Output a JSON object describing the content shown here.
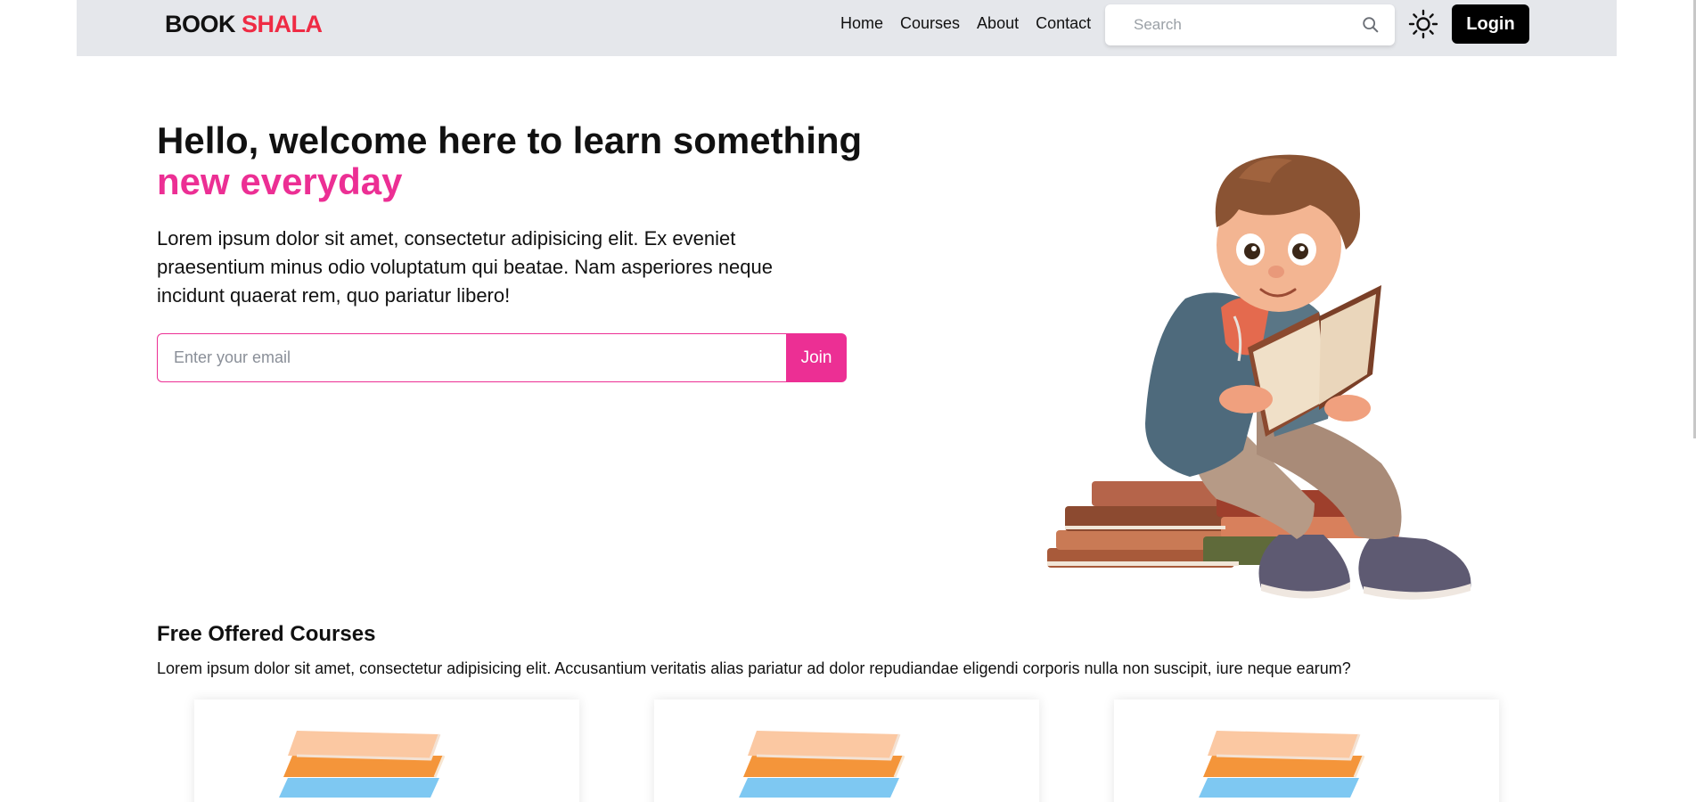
{
  "brand": {
    "part1": "BOOK",
    "part2": "SHALA",
    "accent_color": "#ef2b44"
  },
  "nav": {
    "items": [
      {
        "label": "Home"
      },
      {
        "label": "Courses"
      },
      {
        "label": "About"
      },
      {
        "label": "Contact"
      }
    ]
  },
  "search": {
    "placeholder": "Search",
    "icon": "search-icon"
  },
  "theme_toggle": {
    "icon": "sun-icon"
  },
  "login": {
    "label": "Login"
  },
  "hero": {
    "title": "Hello, welcome here to learn something",
    "title_accent": "new everyday",
    "accent_color": "#ec2f94",
    "description": "Lorem ipsum dolor sit amet, consectetur adipisicing elit. Ex eveniet praesentium minus odio voluptatum qui beatae. Nam asperiores neque incidunt quaerat rem, quo pariatur libero!",
    "email_placeholder": "Enter your email",
    "join_label": "Join",
    "illustration": "boy-reading-book-on-books-illustration"
  },
  "courses": {
    "title": "Free Offered Courses",
    "description": "Lorem ipsum dolor sit amet, consectetur adipisicing elit. Accusantium veritatis alias pariatur ad dolor repudiandae eligendi corporis nulla non suscipit, iure neque earum?",
    "cards": [
      {
        "image": "book-stack-image"
      },
      {
        "image": "book-stack-image"
      },
      {
        "image": "book-stack-image"
      }
    ]
  }
}
